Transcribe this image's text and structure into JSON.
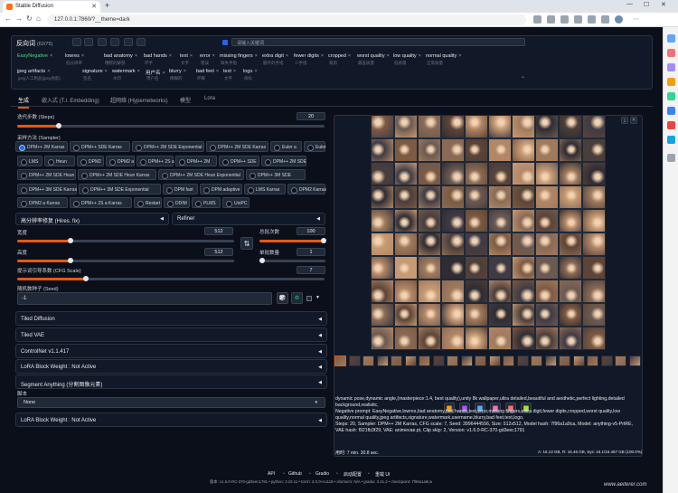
{
  "browser": {
    "tab_title": "Stable Diffusion",
    "url": "127.0.0.1:7860/?__theme=dark",
    "new_tab": "+",
    "close": "✕",
    "window_controls": [
      "—",
      "☐",
      "✕"
    ],
    "nav": [
      "←",
      "→",
      "↻",
      "⌂"
    ]
  },
  "negative": {
    "title": "反向词",
    "count": "(62/75)",
    "filter_placeholder": "请输入关键词",
    "tags": [
      {
        "t": "EasyNegative",
        "s": "",
        "hl": true
      },
      {
        "t": "lowres",
        "s": "低分辨率"
      },
      {
        "t": "bad anatomy",
        "s": "糟糕的解剖"
      },
      {
        "t": "bad hands",
        "s": "坏手"
      },
      {
        "t": "text",
        "s": "文字"
      },
      {
        "t": "error",
        "s": "错误"
      },
      {
        "t": "missing fingers",
        "s": "缺失手指"
      },
      {
        "t": "extra digit",
        "s": "额外的手指"
      },
      {
        "t": "fewer digits",
        "s": "少手指"
      },
      {
        "t": "cropped",
        "s": "裁剪"
      },
      {
        "t": "worst quality",
        "s": "最差质量"
      },
      {
        "t": "low quality",
        "s": "低质量"
      },
      {
        "t": "normal quality",
        "s": "正常质量"
      },
      {
        "t": "jpeg artifacts",
        "s": "jpeg人工制品(jpeg伪影)"
      },
      {
        "t": "signature",
        "s": "签名"
      },
      {
        "t": "watermark",
        "s": "水印"
      },
      {
        "t": "用户名",
        "s": "用户名"
      },
      {
        "t": "blurry",
        "s": "模糊的"
      },
      {
        "t": "bad feet",
        "s": "坏脚"
      },
      {
        "t": "text",
        "s": "文字"
      },
      {
        "t": "logo",
        "s": "商标"
      }
    ]
  },
  "tabs": [
    "生成",
    "嵌入式 (T.I. Embedding)",
    "超网络 (Hypernetworks)",
    "模型",
    "Lora"
  ],
  "steps": {
    "label": "迭代步数 (Steps)",
    "value": "20"
  },
  "sampler": {
    "label": "采样方法 (Sampler)",
    "options": [
      "DPM++ 2M Karras",
      "DPM++ SDE Karras",
      "DPM++ 2M SDE Exponential",
      "DPM++ 2M SDE Karras",
      "Euler a",
      "Euler",
      "LMS",
      "Heun",
      "DPM2",
      "DPM2 a",
      "DPM++ 2S a",
      "DPM++ 2M",
      "DPM++ SDE",
      "DPM++ 2M SDE",
      "DPM++ 2M SDE Heun",
      "DPM++ 2M SDE Heun Karras",
      "DPM++ 2M SDE Heun Exponential",
      "DPM++ 3M SDE",
      "DPM++ 3M SDE Karras",
      "DPM++ 3M SDE Exponential",
      "DPM fast",
      "DPM adaptive",
      "LMS Karras",
      "DPM2 Karras",
      "DPM2 a Karras",
      "DPM++ 2S a Karras",
      "Restart",
      "DDIM",
      "PLMS",
      "UniPC"
    ]
  },
  "hires": {
    "label": "高分辨率修复 (Hires. fix)",
    "refiner": "Refiner"
  },
  "width": {
    "label": "宽度",
    "value": "512"
  },
  "height": {
    "label": "高度",
    "value": "512"
  },
  "batch_count": {
    "label": "总批次数",
    "value": "100"
  },
  "batch_size": {
    "label": "单批数量",
    "value": "1"
  },
  "cfg": {
    "label": "提示词引导系数 (CFG Scale)",
    "value": "7"
  },
  "seed": {
    "label": "随机数种子 (Seed)",
    "value": "-1"
  },
  "swap_icon": "⇅",
  "dice_icon": "🎲",
  "recycle_icon": "♻",
  "accordions": [
    "Tiled Diffusion",
    "Tiled VAE",
    "ControlNet v1.1.417",
    "LoRA Block Weight : Not Active",
    "Segment Anything (分割图像元素)"
  ],
  "script": {
    "label": "脚本",
    "value": "None"
  },
  "lora_block2": "LoRA Block Weight : Not Active",
  "output": {
    "info": "dynamic pose,dynamic angle,(masterpiece:1.4, best quality),unity 8k wallpaper,ultra detailed,beautiful and aesthetic,perfect lighting,detailed background,realistic,",
    "negative": "Negative prompt: EasyNegative,lowres,bad anatomy,bad hands,text,error,missing fingers,extra digit,fewer digits,cropped,worst quality,low quality,normal quality,jpeg artifacts,signature,watermark,username,blurry,bad feet,text,logo,",
    "params": "Steps: 20, Sampler: DPM++ 2M Karras, CFG scale: 7, Seed: 3996444556, Size: 512x512, Model hash: 7f96a1a9ca, Model: anything-v5-PrtRE, VAE hash: f921fb3f29, VAE: animevae.pt, Clip skip: 2, Version: v1.6.0-RC-370-gd3eec1791",
    "time": "用时: 7 min. 30.8 sec.",
    "mem": "A: 16.13 GB, R: 16.46 GB, Sys: 16.1/16.457 GB (100.0%)"
  },
  "footer": {
    "links": [
      "API",
      "Github",
      "Gradio",
      "启动配置",
      "重载 UI"
    ],
    "version": "版本: v1.6.0-RC-370-gd3eec1791  •  python: 3.10.11  •  torch: 2.0.0+cu118  •  xformers: N/A  •  gradio: 3.41.2  •  checkpoint: 7f96a1a9ca"
  },
  "watermark": "www.aeiferer.com"
}
